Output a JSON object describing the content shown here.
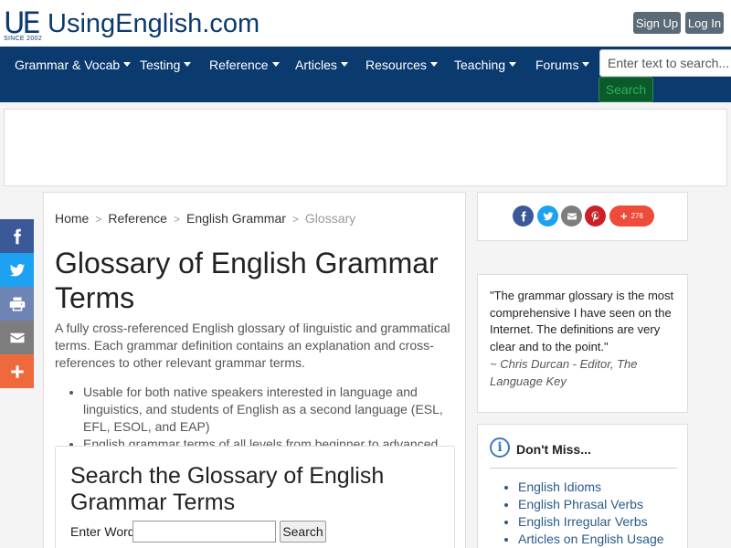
{
  "header": {
    "logo_mark": "UE",
    "logo_since": "SINCE 2002",
    "logo_prefix": "Using",
    "logo_bold": "English",
    "logo_suffix": ".com",
    "signup_label": "Sign Up",
    "login_label": "Log In"
  },
  "nav": {
    "items": [
      {
        "label": "Grammar & Vocab"
      },
      {
        "label": "Testing"
      },
      {
        "label": "Reference"
      },
      {
        "label": "Articles"
      },
      {
        "label": "Resources"
      },
      {
        "label": "Teaching"
      },
      {
        "label": "Forums"
      }
    ],
    "search_placeholder": "Enter text to search...",
    "search_button": "Search"
  },
  "share_sidebar": [
    "facebook-icon",
    "twitter-icon",
    "print-icon",
    "email-icon",
    "more-icon"
  ],
  "colors": {
    "brand": "#0b3a6f",
    "facebook": "#3b5998",
    "twitter": "#1da1f2",
    "print": "#6d84b4",
    "email": "#7d7d7d",
    "more": "#ee6a3d",
    "pinterest": "#cb2027"
  },
  "breadcrumb": {
    "home": "Home",
    "reference": "Reference",
    "grammar": "English Grammar",
    "current": "Glossary"
  },
  "page": {
    "title": "Glossary of English Grammar Terms",
    "intro": "A fully cross-referenced English glossary of linguistic and grammatical terms. Each grammar definition contains an explanation and cross-references to other relevant grammar terms.",
    "bullets": [
      "Usable for both native speakers interested in language and linguistics, and students of English as a second language (ESL, EFL, ESOL, and EAP)",
      "English grammar terms of all levels from beginner to advanced."
    ],
    "search_title": "Search the Glossary of English Grammar Terms",
    "search_label": "Enter Word:",
    "search_button": "Search"
  },
  "social": {
    "icons": [
      "facebook-icon",
      "twitter-icon",
      "email-icon",
      "pinterest-icon"
    ],
    "share_count": "276"
  },
  "testimonial": {
    "quote": "\"The grammar glossary is the most comprehensive I have seen on the Internet. The definitions are very clear and to the point.\"",
    "author": "~ Chris Durcan - Editor, The Language Key"
  },
  "dont_miss": {
    "title": "Don't Miss...",
    "items": [
      "English Idioms",
      "English Phrasal Verbs",
      "English Irregular Verbs",
      "Articles on English Usage"
    ]
  }
}
